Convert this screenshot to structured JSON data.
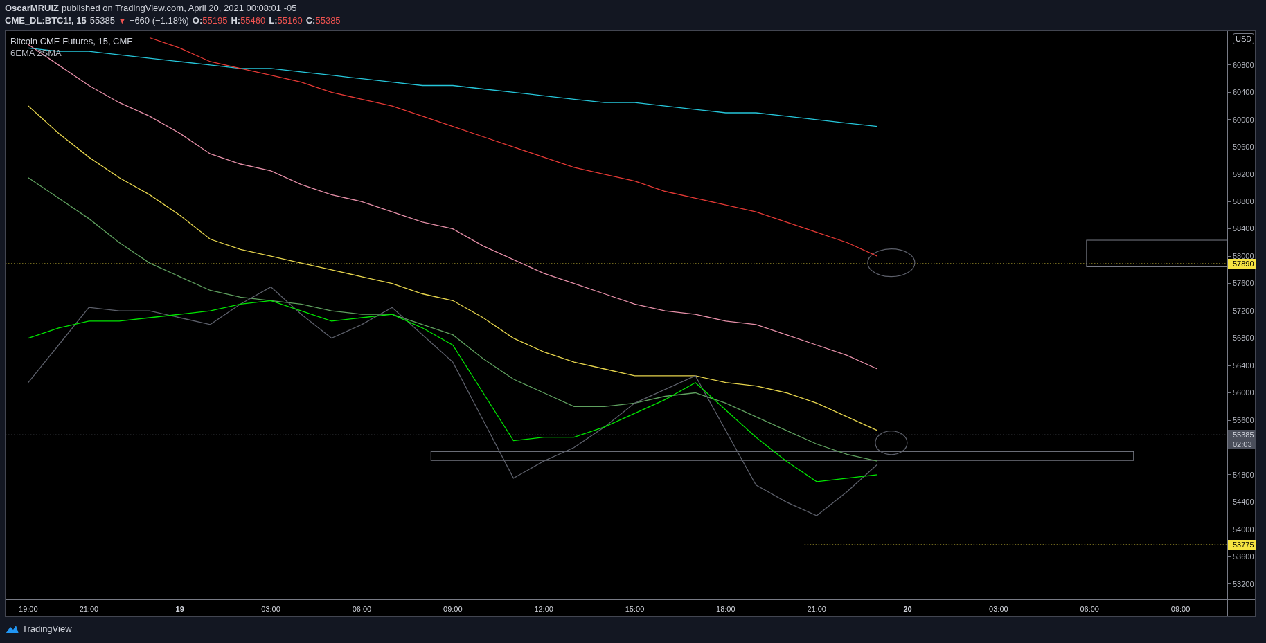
{
  "header": {
    "author": "OscarMRUIZ",
    "published": "published on TradingView.com, April 20, 2021 00:08:01 -05",
    "symbol": "CME_DL:BTC1!, 15",
    "last": "55385",
    "arrow": "▼",
    "change": "−660 (−1.18%)",
    "ohlc": [
      {
        "label": "O:",
        "value": "55195"
      },
      {
        "label": "H:",
        "value": "55460"
      },
      {
        "label": "L:",
        "value": "55160"
      },
      {
        "label": "C:",
        "value": "55385"
      }
    ]
  },
  "legend": {
    "title": "Bitcoin CME Futures, 15, CME",
    "studies": "6EMA 2SMA"
  },
  "currency": "USD",
  "chart_data": {
    "type": "line",
    "categories": [
      "19:00",
      null,
      "21:00",
      null,
      null,
      "19",
      null,
      null,
      "03:00",
      null,
      null,
      "06:00",
      null,
      null,
      "09:00",
      null,
      null,
      "12:00",
      null,
      null,
      "15:00",
      null,
      null,
      "18:00",
      null,
      null,
      "21:00",
      null,
      null,
      "20",
      null,
      null,
      "03:00",
      null,
      null,
      "06:00",
      null,
      null,
      "09:00"
    ],
    "series": [
      {
        "color": "#26c6da",
        "values": [
          61050,
          61000,
          61000,
          60950,
          60900,
          60850,
          60800,
          60750,
          60750,
          60700,
          60650,
          60600,
          60550,
          60500,
          60500,
          60450,
          60400,
          60350,
          60300,
          60250,
          60250,
          60200,
          60150,
          60100,
          60100,
          60050,
          60000,
          59950,
          59900,
          null,
          null,
          null,
          null,
          null,
          null,
          null,
          null,
          null,
          null
        ]
      },
      {
        "color": "#e53935",
        "values": [
          null,
          null,
          null,
          null,
          61200,
          61050,
          60850,
          60750,
          60650,
          60550,
          60400,
          60300,
          60200,
          60050,
          59900,
          59750,
          59600,
          59450,
          59300,
          59200,
          59100,
          58950,
          58850,
          58750,
          58650,
          58500,
          58350,
          58200,
          58000,
          null,
          null,
          null,
          null,
          null,
          null,
          null,
          null,
          null,
          null
        ]
      },
      {
        "color": "#e68fa8",
        "values": [
          61100,
          60800,
          60500,
          60250,
          60050,
          59800,
          59500,
          59350,
          59250,
          59050,
          58900,
          58800,
          58650,
          58500,
          58400,
          58150,
          57950,
          57750,
          57600,
          57450,
          57300,
          57200,
          57150,
          57050,
          57000,
          56850,
          56700,
          56550,
          56350,
          null,
          null,
          null,
          null,
          null,
          null,
          null,
          null,
          null,
          null
        ]
      },
      {
        "color": "#e6d44c",
        "values": [
          60200,
          59800,
          59450,
          59150,
          58900,
          58600,
          58250,
          58100,
          58000,
          57900,
          57800,
          57700,
          57600,
          57450,
          57350,
          57100,
          56800,
          56600,
          56450,
          56350,
          56250,
          56250,
          56250,
          56150,
          56100,
          56000,
          55850,
          55650,
          55450,
          null,
          null,
          null,
          null,
          null,
          null,
          null,
          null,
          null,
          null
        ]
      },
      {
        "color": "#5fa05f",
        "values": [
          59150,
          58850,
          58550,
          58200,
          57900,
          57700,
          57500,
          57400,
          57350,
          57300,
          57200,
          57150,
          57150,
          57000,
          56850,
          56500,
          56200,
          56000,
          55800,
          55800,
          55850,
          55950,
          56000,
          55850,
          55650,
          55450,
          55250,
          55100,
          55000,
          null,
          null,
          null,
          null,
          null,
          null,
          null,
          null,
          null,
          null
        ]
      },
      {
        "color": "#5d606b",
        "values": [
          56150,
          56700,
          57250,
          57200,
          57200,
          57100,
          57000,
          57300,
          57550,
          57150,
          56800,
          57000,
          57250,
          56850,
          56450,
          55600,
          54750,
          55000,
          55200,
          55500,
          55850,
          56050,
          56250,
          55450,
          54650,
          54400,
          54200,
          54550,
          54950,
          null,
          null,
          null,
          null,
          null,
          null,
          null,
          null,
          null,
          null
        ]
      },
      {
        "color": "#00e600",
        "values": [
          56800,
          56950,
          57050,
          57050,
          57100,
          57150,
          57200,
          57300,
          57350,
          57200,
          57050,
          57100,
          57150,
          56950,
          56700,
          56000,
          55300,
          55350,
          55350,
          55500,
          55700,
          55900,
          56150,
          55750,
          55350,
          55000,
          54700,
          54750,
          54800,
          null,
          null,
          null,
          null,
          null,
          null,
          null,
          null,
          null,
          null
        ]
      }
    ],
    "ylim": [
      52975,
      61296
    ],
    "yticks": [
      53200,
      53600,
      54000,
      54400,
      54800,
      55600,
      56000,
      56400,
      56800,
      57200,
      57600,
      58000,
      58400,
      58800,
      59200,
      59600,
      60000,
      60400,
      60800
    ],
    "ref_lines": [
      {
        "axis": "y",
        "value": 57890,
        "label": "57890"
      },
      {
        "axis": "y",
        "value": 53775,
        "label": "53775"
      },
      {
        "axis": "y",
        "value": 55385,
        "label": "55385"
      }
    ]
  },
  "countdown": "02:03",
  "footer": {
    "brand": "TradingView"
  }
}
